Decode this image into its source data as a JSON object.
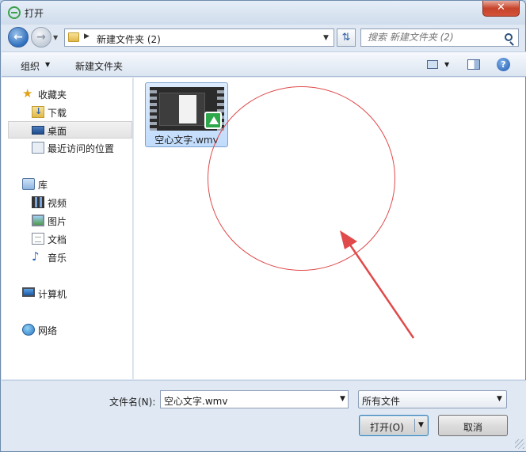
{
  "window": {
    "title": "打开",
    "close_label": "✕"
  },
  "address": {
    "current_folder": "新建文件夹 (2)",
    "search_placeholder": "搜索 新建文件夹 (2)"
  },
  "toolbar": {
    "organize_label": "组织",
    "new_folder_label": "新建文件夹"
  },
  "nav": {
    "favorites_label": "收藏夹",
    "favorites_items": [
      {
        "label": "下载",
        "icon": "download-folder-icon"
      },
      {
        "label": "桌面",
        "icon": "desktop-icon"
      },
      {
        "label": "最近访问的位置",
        "icon": "recent-places-icon"
      }
    ],
    "libraries_label": "库",
    "libraries_items": [
      {
        "label": "视频",
        "icon": "video-library-icon"
      },
      {
        "label": "图片",
        "icon": "pictures-library-icon"
      },
      {
        "label": "文档",
        "icon": "documents-library-icon"
      },
      {
        "label": "音乐",
        "icon": "music-library-icon"
      }
    ],
    "computer_label": "计算机",
    "network_label": "网络"
  },
  "files": [
    {
      "name": "空心文字.wmv",
      "type": "video-file",
      "selected": true
    }
  ],
  "bottom": {
    "filename_label": "文件名(N):",
    "filename_value": "空心文字.wmv",
    "filetype_value": "所有文件",
    "open_label": "打开(O)",
    "cancel_label": "取消"
  },
  "colors": {
    "annotation": "#e04a4a",
    "selection": "#c1dcfc",
    "titlebar": "#cfdcec"
  }
}
